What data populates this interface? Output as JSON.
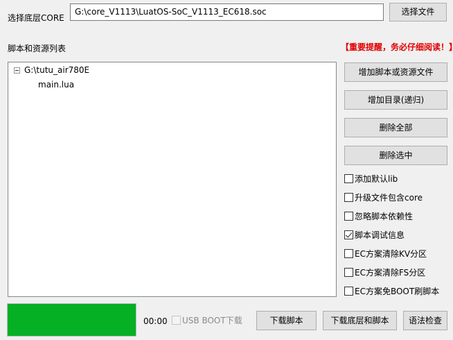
{
  "core": {
    "label": "选择底层CORE",
    "path": "G:\\core_V1113\\LuatOS-SoC_V1113_EC618.soc",
    "choose_button": "选择文件"
  },
  "scripts": {
    "label": "脚本和资源列表",
    "warning": "【重要提醒，务必仔细阅读！】",
    "tree": {
      "folder": "G:\\tutu_air780E",
      "files": [
        "main.lua"
      ]
    }
  },
  "side_buttons": {
    "add_files": "增加脚本或资源文件",
    "add_dir": "增加目录(递归)",
    "delete_all": "删除全部",
    "delete_selected": "删除选中"
  },
  "options": [
    {
      "label": "添加默认lib",
      "checked": false
    },
    {
      "label": "升级文件包含core",
      "checked": false
    },
    {
      "label": "忽略脚本依赖性",
      "checked": false
    },
    {
      "label": "脚本调试信息",
      "checked": true
    },
    {
      "label": "EC方案清除KV分区",
      "checked": false
    },
    {
      "label": "EC方案清除FS分区",
      "checked": false
    },
    {
      "label": "EC方案免BOOT刷脚本",
      "checked": false
    }
  ],
  "bottom": {
    "progress": 1.0,
    "progress_color": "#06b025",
    "time": "00:00",
    "usb_boot_label": "USB BOOT下载",
    "usb_boot_checked": false,
    "download_script": "下载脚本",
    "download_core_script": "下载底层和脚本",
    "syntax_check": "语法检查"
  }
}
